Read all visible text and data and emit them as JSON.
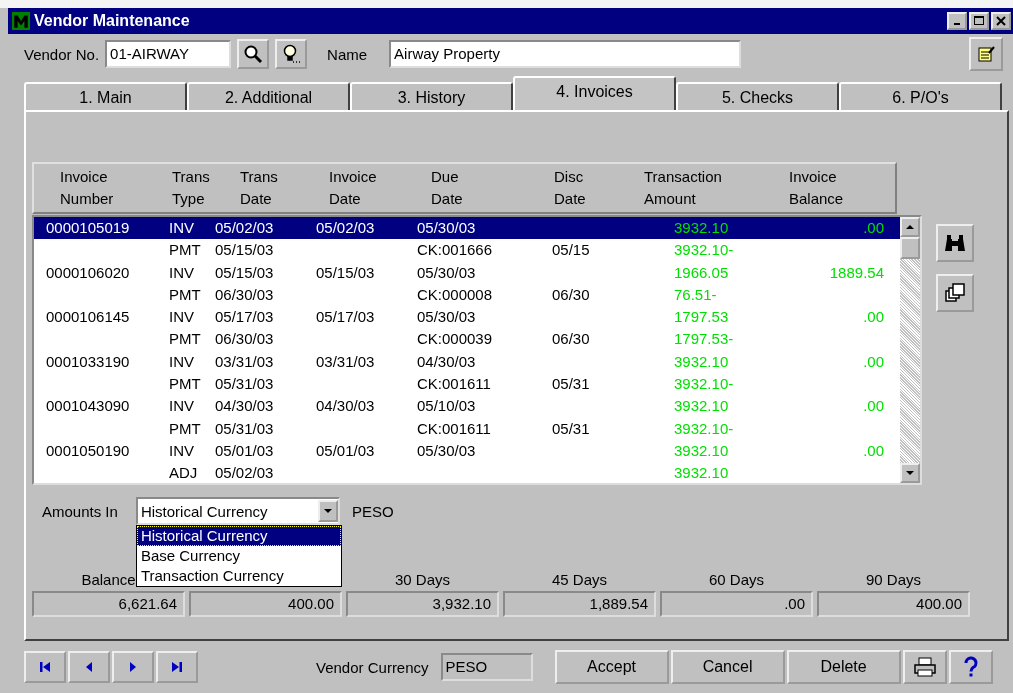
{
  "window": {
    "title": "Vendor Maintenance"
  },
  "vendor_no": {
    "label": "Vendor No.",
    "value": "01-AIRWAY"
  },
  "name": {
    "label": "Name",
    "value": "Airway Property"
  },
  "tabs": [
    {
      "label": "1. Main",
      "selected": false
    },
    {
      "label": "2. Additional",
      "selected": false
    },
    {
      "label": "3. History",
      "selected": false
    },
    {
      "label": "4. Invoices",
      "selected": true
    },
    {
      "label": "5. Checks",
      "selected": false
    },
    {
      "label": "6. P/O's",
      "selected": false
    }
  ],
  "table": {
    "columns": [
      [
        "Invoice",
        "Number"
      ],
      [
        "Trans",
        "Type"
      ],
      [
        "Trans",
        "Date"
      ],
      [
        "Invoice",
        "Date"
      ],
      [
        "Due",
        "Date"
      ],
      [
        "Disc",
        "Date"
      ],
      [
        "Transaction",
        "Amount"
      ],
      [
        "Invoice",
        "Balance"
      ]
    ],
    "rows": [
      {
        "invoice": "0000105019",
        "type": "INV",
        "trans_date": "05/02/03",
        "invoice_date": "05/02/03",
        "due": "05/30/03",
        "disc": "",
        "amount": "3932.10",
        "balance": ".00",
        "selected": true
      },
      {
        "invoice": "",
        "type": "PMT",
        "trans_date": "05/15/03",
        "invoice_date": "",
        "due": "CK:001666",
        "disc": "05/15",
        "amount": "3932.10-",
        "balance": "",
        "selected": false
      },
      {
        "invoice": "0000106020",
        "type": "INV",
        "trans_date": "05/15/03",
        "invoice_date": "05/15/03",
        "due": "05/30/03",
        "disc": "",
        "amount": "1966.05",
        "balance": "1889.54",
        "selected": false
      },
      {
        "invoice": "",
        "type": "PMT",
        "trans_date": "06/30/03",
        "invoice_date": "",
        "due": "CK:000008",
        "disc": "06/30",
        "amount": "76.51-",
        "balance": "",
        "selected": false
      },
      {
        "invoice": "0000106145",
        "type": "INV",
        "trans_date": "05/17/03",
        "invoice_date": "05/17/03",
        "due": "05/30/03",
        "disc": "",
        "amount": "1797.53",
        "balance": ".00",
        "selected": false
      },
      {
        "invoice": "",
        "type": "PMT",
        "trans_date": "06/30/03",
        "invoice_date": "",
        "due": "CK:000039",
        "disc": "06/30",
        "amount": "1797.53-",
        "balance": "",
        "selected": false
      },
      {
        "invoice": "0001033190",
        "type": "INV",
        "trans_date": "03/31/03",
        "invoice_date": "03/31/03",
        "due": "04/30/03",
        "disc": "",
        "amount": "3932.10",
        "balance": ".00",
        "selected": false
      },
      {
        "invoice": "",
        "type": "PMT",
        "trans_date": "05/31/03",
        "invoice_date": "",
        "due": "CK:001611",
        "disc": "05/31",
        "amount": "3932.10-",
        "balance": "",
        "selected": false
      },
      {
        "invoice": "0001043090",
        "type": "INV",
        "trans_date": "04/30/03",
        "invoice_date": "04/30/03",
        "due": "05/10/03",
        "disc": "",
        "amount": "3932.10",
        "balance": ".00",
        "selected": false
      },
      {
        "invoice": "",
        "type": "PMT",
        "trans_date": "05/31/03",
        "invoice_date": "",
        "due": "CK:001611",
        "disc": "05/31",
        "amount": "3932.10-",
        "balance": "",
        "selected": false
      },
      {
        "invoice": "0001050190",
        "type": "INV",
        "trans_date": "05/01/03",
        "invoice_date": "05/01/03",
        "due": "05/30/03",
        "disc": "",
        "amount": "3932.10",
        "balance": ".00",
        "selected": false
      },
      {
        "invoice": "",
        "type": "ADJ",
        "trans_date": "05/02/03",
        "invoice_date": "",
        "due": "",
        "disc": "",
        "amount": "3932.10",
        "balance": "",
        "selected": false
      }
    ]
  },
  "amounts_in": {
    "label": "Amounts In",
    "value": "Historical Currency",
    "currency": "PESO",
    "options": [
      {
        "label": "Historical Currency",
        "selected": true
      },
      {
        "label": "Base Currency",
        "selected": false
      },
      {
        "label": "Transaction Currency",
        "selected": false
      }
    ]
  },
  "aging": [
    {
      "label": "Balance",
      "value": "6,621.64"
    },
    {
      "value": "400.00"
    },
    {
      "label": "30 Days",
      "value": "3,932.10"
    },
    {
      "label": "45 Days",
      "value": "1,889.54"
    },
    {
      "label": "60 Days",
      "value": ".00"
    },
    {
      "label": "90 Days",
      "value": "400.00"
    }
  ],
  "vendor_currency": {
    "label": "Vendor Currency",
    "value": "PESO"
  },
  "buttons": [
    "Accept",
    "Cancel",
    "Delete"
  ]
}
